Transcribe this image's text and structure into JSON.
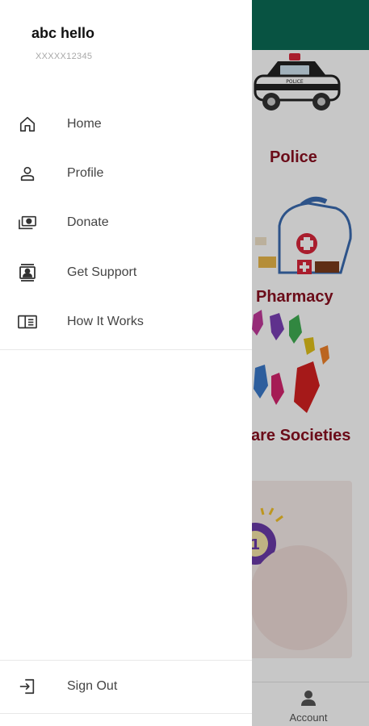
{
  "drawer": {
    "user": {
      "name": "abc hello",
      "id": "XXXXX12345"
    },
    "menu": [
      {
        "label": "Home",
        "icon": "home-icon"
      },
      {
        "label": "Profile",
        "icon": "person-icon"
      },
      {
        "label": "Donate",
        "icon": "donate-icon"
      },
      {
        "label": "Get Support",
        "icon": "support-icon"
      },
      {
        "label": "How It Works",
        "icon": "book-icon"
      }
    ],
    "sign_out": {
      "label": "Sign Out",
      "icon": "sign-out-icon"
    }
  },
  "background": {
    "categories": [
      {
        "label": "Police",
        "icon": "police-car-icon"
      },
      {
        "label": "Pharmacy",
        "icon": "medical-kit-icon"
      },
      {
        "label": "are Societies",
        "icon": "hands-icon"
      }
    ],
    "bottom_nav": {
      "account_label": "Account",
      "icon": "account-icon"
    }
  },
  "colors": {
    "header": "#0b6b55",
    "category_label": "#8a1020",
    "drawer_text": "#444444"
  }
}
